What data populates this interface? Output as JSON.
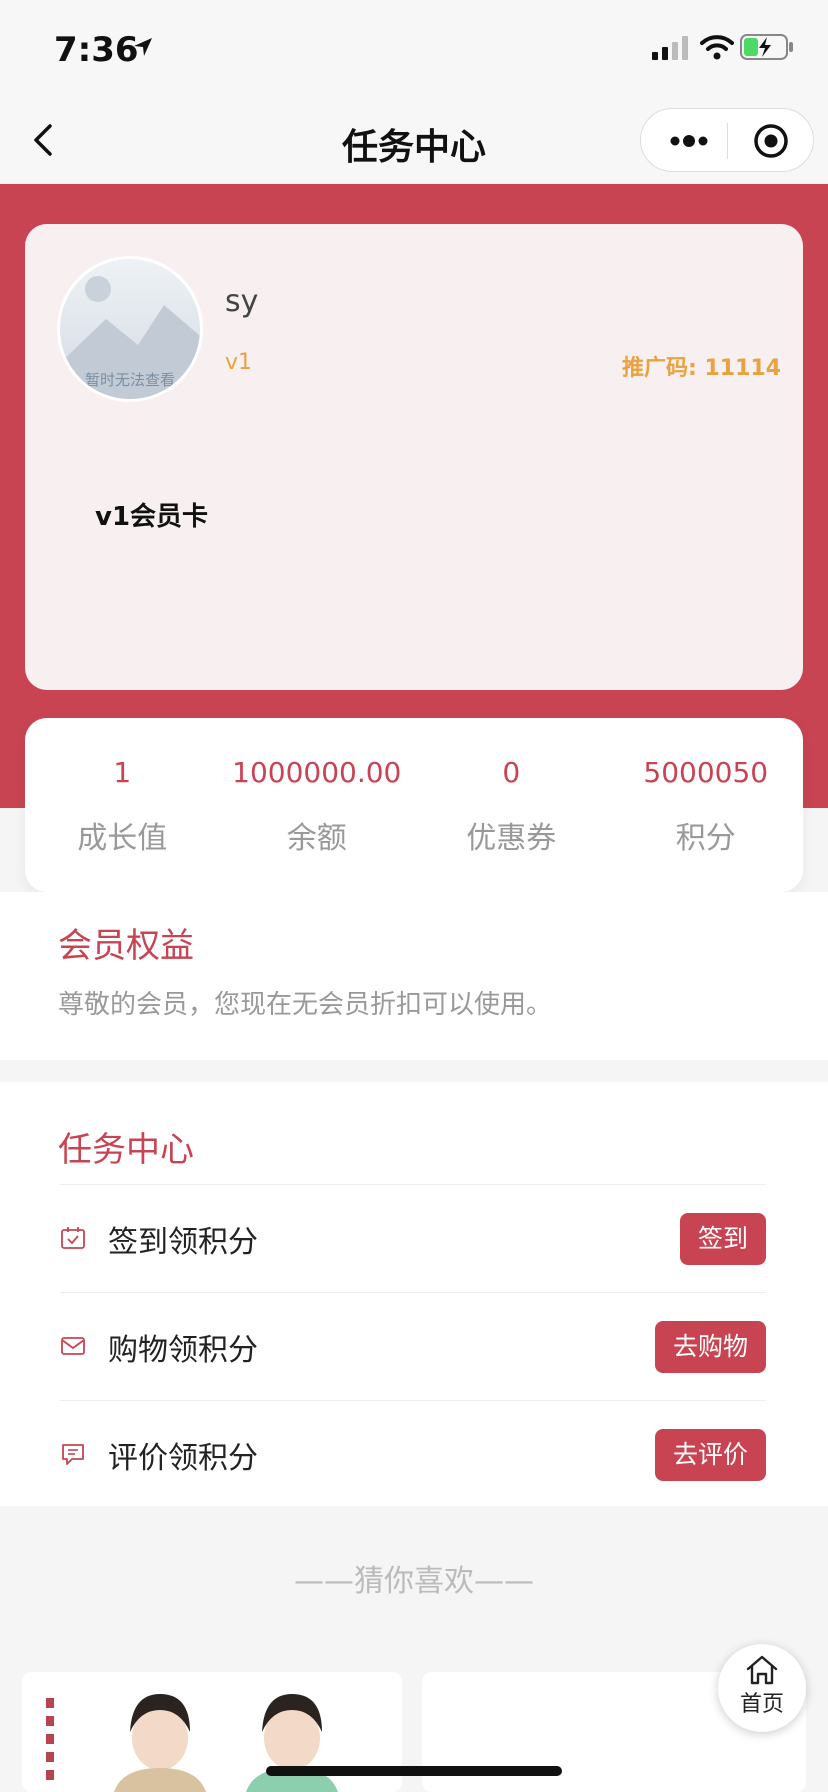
{
  "status_bar": {
    "time": "7:36"
  },
  "nav": {
    "title": "任务中心"
  },
  "profile": {
    "avatar_text": "暂时无法查看",
    "username": "sy",
    "level": "v1",
    "promo_code": "推广码: 11114",
    "card_title": "v1会员卡"
  },
  "stats": [
    {
      "value": "1",
      "label": "成长值"
    },
    {
      "value": "1000000.00",
      "label": "余额"
    },
    {
      "value": "0",
      "label": "优惠券"
    },
    {
      "value": "5000050",
      "label": "积分"
    }
  ],
  "benefits": {
    "title": "会员权益",
    "description": "尊敬的会员，您现在无会员折扣可以使用。"
  },
  "tasks": {
    "title": "任务中心",
    "items": [
      {
        "label": "签到领积分",
        "button": "签到",
        "icon": "calendar-check-icon"
      },
      {
        "label": "购物领积分",
        "button": "去购物",
        "icon": "envelope-icon"
      },
      {
        "label": "评价领积分",
        "button": "去评价",
        "icon": "comment-icon"
      }
    ]
  },
  "recommend": {
    "title": "——猜你喜欢——"
  },
  "home_button": {
    "label": "首页"
  },
  "colors": {
    "brand": "#c94452",
    "accent": "#e8a23f"
  }
}
